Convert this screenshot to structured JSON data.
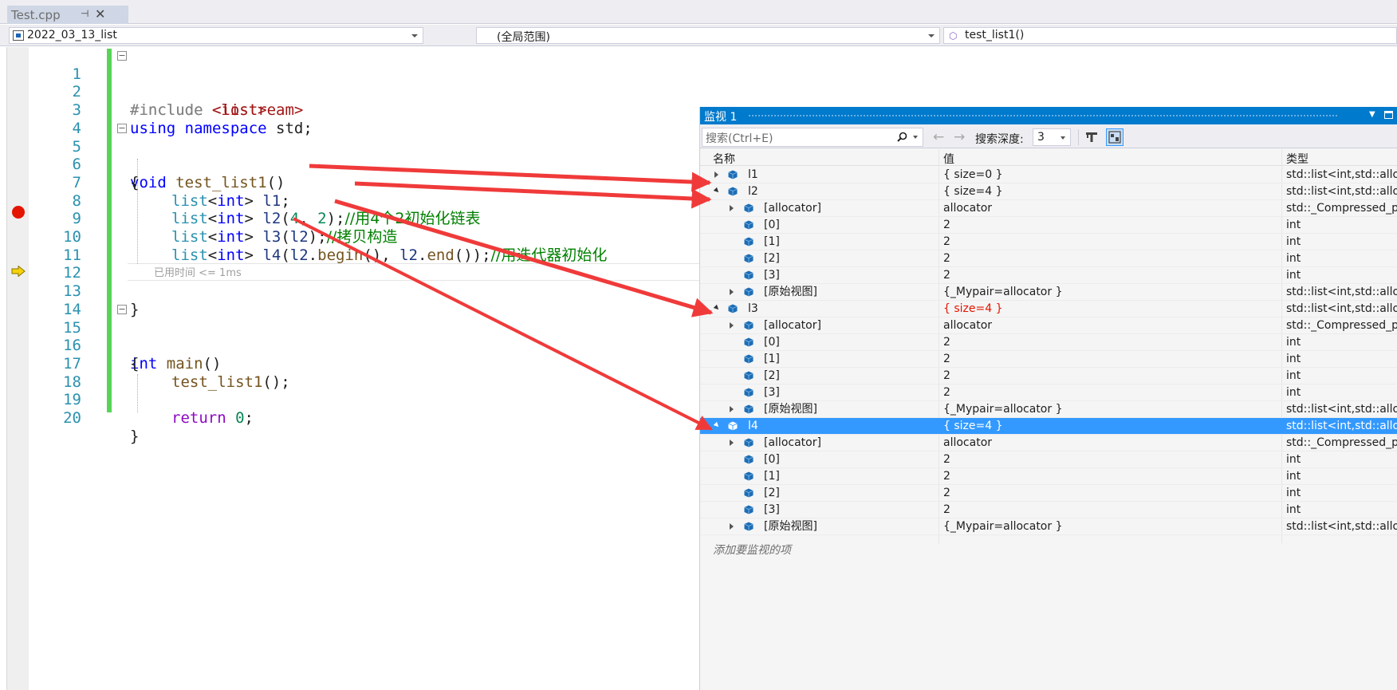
{
  "tab": {
    "title": "Test.cpp",
    "pin": "⊣",
    "close": "✕"
  },
  "navbar": {
    "project": "2022_03_13_list",
    "scope": "(全局范围)",
    "member": "test_list1()"
  },
  "editor": {
    "lines": [
      {
        "n": "1"
      },
      {
        "n": "2"
      },
      {
        "n": "3"
      },
      {
        "n": "4"
      },
      {
        "n": "5"
      },
      {
        "n": "6"
      },
      {
        "n": "7"
      },
      {
        "n": "8"
      },
      {
        "n": "9"
      },
      {
        "n": "10"
      },
      {
        "n": "11"
      },
      {
        "n": "12"
      },
      {
        "n": "13"
      },
      {
        "n": "14"
      },
      {
        "n": "15"
      },
      {
        "n": "16"
      },
      {
        "n": "17"
      },
      {
        "n": "18"
      },
      {
        "n": "19"
      },
      {
        "n": "20"
      }
    ],
    "code": {
      "l1_a": "#include ",
      "l1_b": "<iostream>",
      "l2_a": "#include ",
      "l2_b": "<list>",
      "l3_a": "using",
      "l3_b": " ",
      "l3_c": "namespace",
      "l3_d": " std;",
      "l5_a": "void",
      "l5_b": " ",
      "l5_c": "test_list1",
      "l5_d": "()",
      "l6": "{",
      "l7_a": "list",
      "l7_b": "<",
      "l7_c": "int",
      "l7_d": "> ",
      "l7_e": "l1",
      "l7_f": ";",
      "l8_a": "list",
      "l8_b": "<",
      "l8_c": "int",
      "l8_d": "> ",
      "l8_e": "l2",
      "l8_f": "(",
      "l8_g": "4",
      "l8_h": ", ",
      "l8_i": "2",
      "l8_j": ");",
      "l8_k": "//用4个2初始化链表",
      "l9_a": "list",
      "l9_b": "<",
      "l9_c": "int",
      "l9_d": "> ",
      "l9_e": "l3",
      "l9_f": "(",
      "l9_g": "l2",
      "l9_h": ");",
      "l9_i": "//拷贝构造",
      "l10_a": "list",
      "l10_b": "<",
      "l10_c": "int",
      "l10_d": "> ",
      "l10_e": "l4",
      "l10_f": "(",
      "l10_g": "l2",
      "l10_h": ".",
      "l10_i": "begin",
      "l10_j": "(), ",
      "l10_k": "l2",
      "l10_l": ".",
      "l10_m": "end",
      "l10_n": "());",
      "l10_o": "//用迭代器初始化",
      "l13_a": "}",
      "l13_hint": "已用时间 <= 1ms",
      "l15_a": "int",
      "l15_b": " ",
      "l15_c": "main",
      "l15_d": "()",
      "l16": "{",
      "l17_a": "test_list1",
      "l17_b": "();",
      "l19_a": "return",
      "l19_b": " ",
      "l19_c": "0",
      "l19_d": ";",
      "l20": "}"
    },
    "fold_minus": "−"
  },
  "watch": {
    "title": "监视 1",
    "search_placeholder": "搜索(Ctrl+E)",
    "back_arrow": "←",
    "forward_arrow": "→",
    "depth_label": "搜索深度:",
    "depth_value": "3",
    "columns": {
      "name": "名称",
      "value": "值",
      "type": "类型"
    },
    "rows": [
      {
        "name": "l1",
        "value": "{ size=0 }",
        "type": "std::list<int,std::allo..."
      },
      {
        "name": "l2",
        "value": "{ size=4 }",
        "type": "std::list<int,std::allo..."
      },
      {
        "name": "[allocator]",
        "value": "allocator",
        "type": "std::_Compressed_p..."
      },
      {
        "name": "[0]",
        "value": "2",
        "type": "int"
      },
      {
        "name": "[1]",
        "value": "2",
        "type": "int"
      },
      {
        "name": "[2]",
        "value": "2",
        "type": "int"
      },
      {
        "name": "[3]",
        "value": "2",
        "type": "int"
      },
      {
        "name": "[原始视图]",
        "value": "{_Mypair=allocator }",
        "type": "std::list<int,std::allo..."
      },
      {
        "name": "l3",
        "value": "{ size=4 }",
        "type": "std::list<int,std::allo..."
      },
      {
        "name": "[allocator]",
        "value": "allocator",
        "type": "std::_Compressed_p..."
      },
      {
        "name": "[0]",
        "value": "2",
        "type": "int"
      },
      {
        "name": "[1]",
        "value": "2",
        "type": "int"
      },
      {
        "name": "[2]",
        "value": "2",
        "type": "int"
      },
      {
        "name": "[3]",
        "value": "2",
        "type": "int"
      },
      {
        "name": "[原始视图]",
        "value": "{_Mypair=allocator }",
        "type": "std::list<int,std::allo..."
      },
      {
        "name": "l4",
        "value": "{ size=4 }",
        "type": "std::list<int,std::allo..."
      },
      {
        "name": "[allocator]",
        "value": "allocator",
        "type": "std::_Compressed_p..."
      },
      {
        "name": "[0]",
        "value": "2",
        "type": "int"
      },
      {
        "name": "[1]",
        "value": "2",
        "type": "int"
      },
      {
        "name": "[2]",
        "value": "2",
        "type": "int"
      },
      {
        "name": "[3]",
        "value": "2",
        "type": "int"
      },
      {
        "name": "[原始视图]",
        "value": "{_Mypair=allocator }",
        "type": "std::list<int,std::allo..."
      }
    ],
    "add_watch": "添加要监视的项"
  },
  "colors": {
    "accent": "#007acc",
    "selection": "#3399ff",
    "changed_value": "#e51400",
    "annotation_arrow": "#f03a3a",
    "change_bar": "#57d457",
    "breakpoint": "#e51400"
  },
  "icons": [
    "breakpoint-icon",
    "instruction-pointer-icon",
    "search-icon",
    "object-icon",
    "filter-icon",
    "hex-icon"
  ]
}
